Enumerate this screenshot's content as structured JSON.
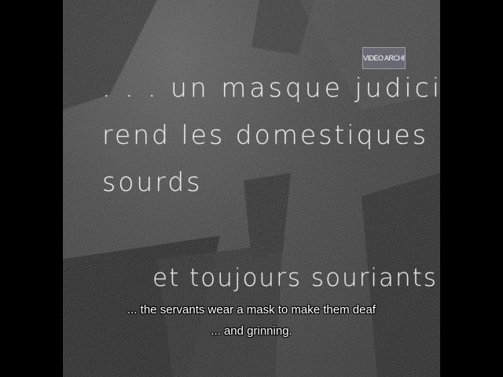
{
  "watermark": "VIDEO ARCHIVE",
  "intertitle": {
    "line1": ". . . un masque judicieux",
    "line2": "rend les domestiques",
    "line3": "sourds",
    "line4": "et toujours souriants"
  },
  "subtitles": {
    "line1": "... the servants wear a mask to make them deaf",
    "line2": "... and grinning."
  }
}
